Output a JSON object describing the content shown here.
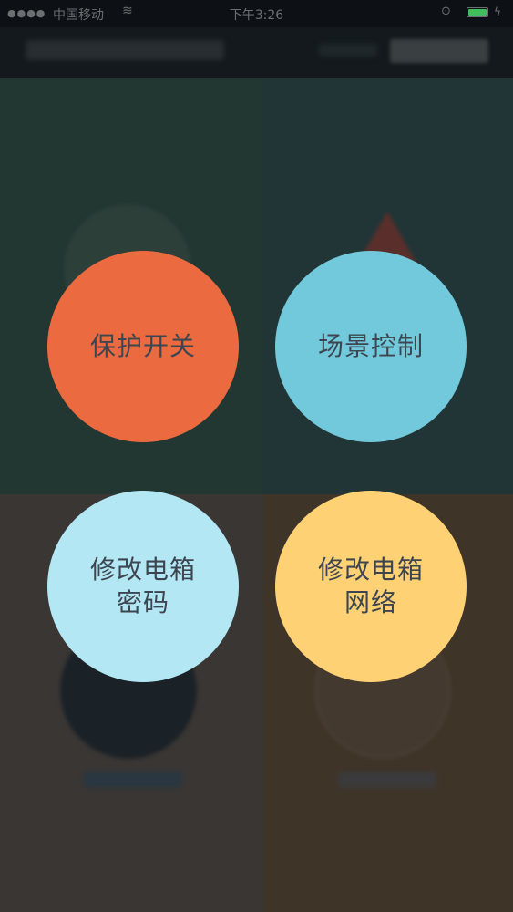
{
  "status_bar": {
    "signal": "●●●●",
    "carrier": "中国移动",
    "wifi_icon": "wifi-icon",
    "time": "下午3:26",
    "lock_icon": "orientation-lock-icon",
    "battery_color": "#3fbe5b"
  },
  "menu": {
    "items": [
      {
        "line1": "保护开关",
        "line2": "",
        "color": "#ec6a3f"
      },
      {
        "line1": "场景控制",
        "line2": "",
        "color": "#71c9db"
      },
      {
        "line1": "修改电箱",
        "line2": "密码",
        "color": "#b3e7f4"
      },
      {
        "line1": "修改电箱",
        "line2": "网络",
        "color": "#fed174"
      }
    ],
    "text_color": "#3d4650"
  }
}
